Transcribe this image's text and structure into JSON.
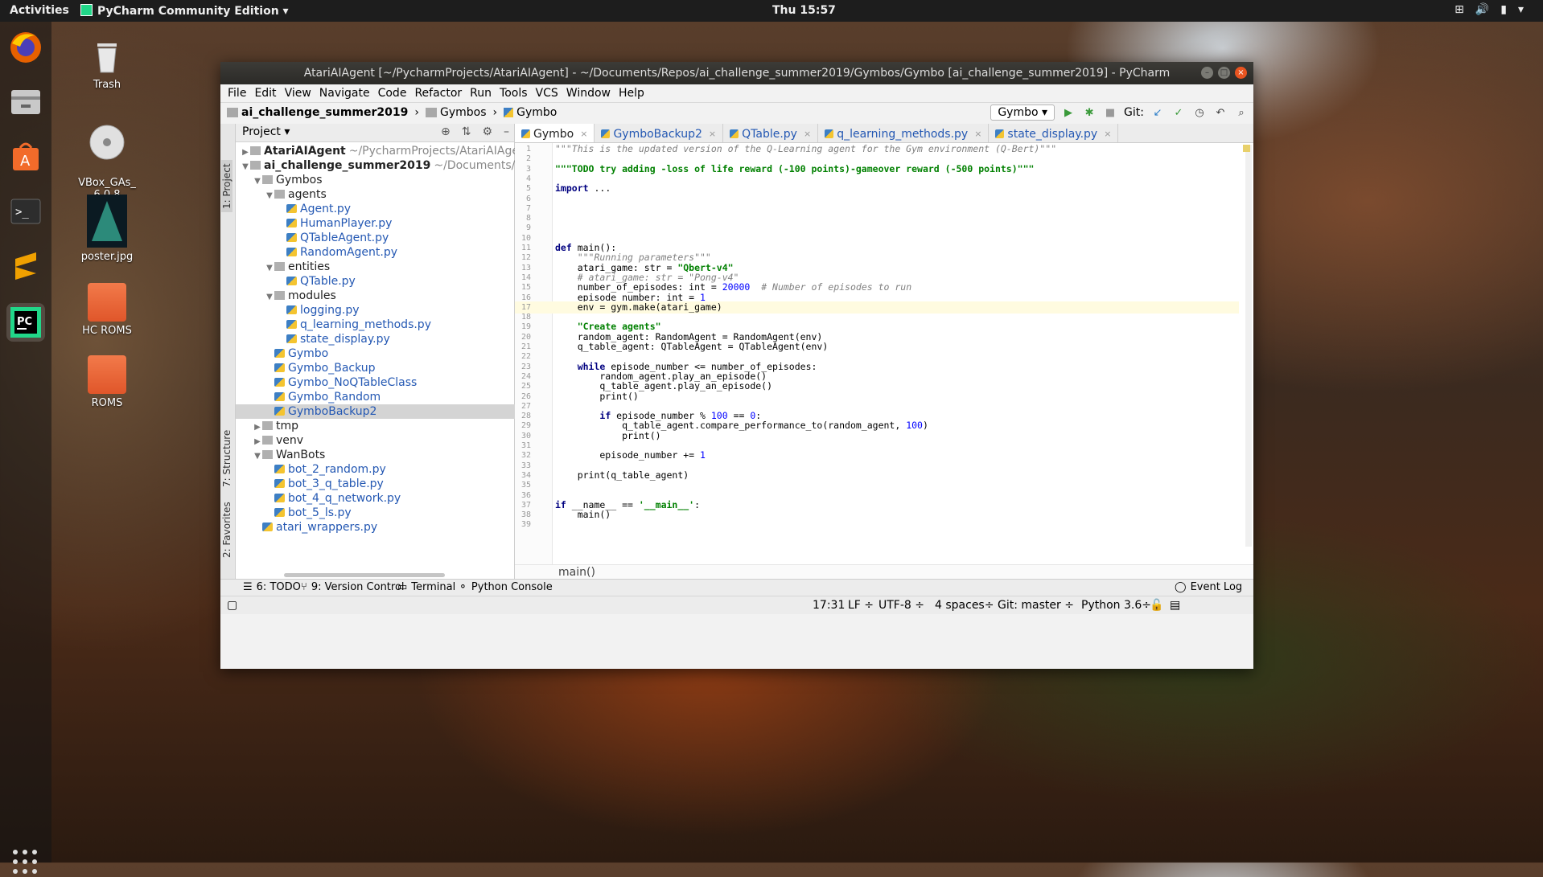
{
  "topbar": {
    "activities": "Activities",
    "app_menu": "PyCharm Community Edition",
    "clock": "Thu 15:57"
  },
  "desktop": {
    "trash": "Trash",
    "vbox": "VBox_GAs_\n6.0.8",
    "poster": "poster.jpg",
    "hc_roms": "HC ROMS",
    "roms": "ROMS"
  },
  "window": {
    "title": "AtariAIAgent [~/PycharmProjects/AtariAIAgent] - ~/Documents/Repos/ai_challenge_summer2019/Gymbos/Gymbo [ai_challenge_summer2019] - PyCharm",
    "menu": [
      "File",
      "Edit",
      "View",
      "Navigate",
      "Code",
      "Refactor",
      "Run",
      "Tools",
      "VCS",
      "Window",
      "Help"
    ],
    "breadcrumbs": [
      "ai_challenge_summer2019",
      "Gymbos",
      "Gymbo"
    ],
    "run_config": "Gymbo",
    "git_label": "Git:",
    "side_tabs": {
      "project": "1: Project",
      "structure": "7: Structure",
      "favorites": "2: Favorites"
    }
  },
  "project_panel": {
    "title": "Project",
    "tree": [
      {
        "name": "AtariAIAgent",
        "path": "~/PycharmProjects/AtariAIAgent",
        "level": 0,
        "type": "root",
        "arrow": "▶"
      },
      {
        "name": "ai_challenge_summer2019",
        "path": "~/Documents/Repos/ai_cha",
        "level": 0,
        "type": "root",
        "arrow": "▼"
      },
      {
        "name": "Gymbos",
        "level": 1,
        "type": "dir",
        "arrow": "▼"
      },
      {
        "name": "agents",
        "level": 2,
        "type": "dir",
        "arrow": "▼"
      },
      {
        "name": "Agent.py",
        "level": 3,
        "type": "file"
      },
      {
        "name": "HumanPlayer.py",
        "level": 3,
        "type": "file"
      },
      {
        "name": "QTableAgent.py",
        "level": 3,
        "type": "file"
      },
      {
        "name": "RandomAgent.py",
        "level": 3,
        "type": "file"
      },
      {
        "name": "entities",
        "level": 2,
        "type": "dir",
        "arrow": "▼"
      },
      {
        "name": "QTable.py",
        "level": 3,
        "type": "file"
      },
      {
        "name": "modules",
        "level": 2,
        "type": "dir",
        "arrow": "▼"
      },
      {
        "name": "logging.py",
        "level": 3,
        "type": "file"
      },
      {
        "name": "q_learning_methods.py",
        "level": 3,
        "type": "file"
      },
      {
        "name": "state_display.py",
        "level": 3,
        "type": "file"
      },
      {
        "name": "Gymbo",
        "level": 2,
        "type": "file"
      },
      {
        "name": "Gymbo_Backup",
        "level": 2,
        "type": "file"
      },
      {
        "name": "Gymbo_NoQTableClass",
        "level": 2,
        "type": "file"
      },
      {
        "name": "Gymbo_Random",
        "level": 2,
        "type": "file"
      },
      {
        "name": "GymboBackup2",
        "level": 2,
        "type": "file",
        "selected": true
      },
      {
        "name": "tmp",
        "level": 1,
        "type": "dir",
        "arrow": "▶"
      },
      {
        "name": "venv",
        "level": 1,
        "type": "dir",
        "arrow": "▶"
      },
      {
        "name": "WanBots",
        "level": 1,
        "type": "dir",
        "arrow": "▼"
      },
      {
        "name": "bot_2_random.py",
        "level": 2,
        "type": "file"
      },
      {
        "name": "bot_3_q_table.py",
        "level": 2,
        "type": "file"
      },
      {
        "name": "bot_4_q_network.py",
        "level": 2,
        "type": "file"
      },
      {
        "name": "bot_5_ls.py",
        "level": 2,
        "type": "file"
      },
      {
        "name": "atari_wrappers.py",
        "level": 1,
        "type": "file"
      }
    ]
  },
  "editor": {
    "tabs": [
      {
        "label": "Gymbo",
        "active": true
      },
      {
        "label": "GymboBackup2",
        "active": false
      },
      {
        "label": "QTable.py",
        "active": false
      },
      {
        "label": "q_learning_methods.py",
        "active": false
      },
      {
        "label": "state_display.py",
        "active": false
      }
    ],
    "lines": [
      "\"\"\"This is the updated version of the Q-Learning agent for the Gym environment (Q-Bert)\"\"\"",
      "",
      "\"\"\"TODO try adding -loss of life reward (-100 points)-gameover reward (-500 points)\"\"\"",
      "",
      "import ...",
      "",
      "",
      "",
      "",
      "",
      "def main():",
      "    \"\"\"Running parameters\"\"\"",
      "    atari_game: str = \"Qbert-v4\"",
      "    # atari_game: str = \"Pong-v4\"",
      "    number_of_episodes: int = 20000  # Number of episodes to run",
      "    episode_number: int = 1",
      "    env = gym.make(atari_game)",
      "",
      "    \"Create agents\"",
      "    random_agent: RandomAgent = RandomAgent(env)",
      "    q_table_agent: QTableAgent = QTableAgent(env)",
      "",
      "    while episode_number <= number_of_episodes:",
      "        random_agent.play_an_episode()",
      "        q_table_agent.play_an_episode()",
      "        print()",
      "",
      "        if episode_number % 100 == 0:",
      "            q_table_agent.compare_performance_to(random_agent, 100)",
      "            print()",
      "",
      "        episode_number += 1",
      "",
      "    print(q_table_agent)",
      "",
      "",
      "if __name__ == '__main__':",
      "    main()",
      ""
    ],
    "current_line": 17,
    "breadcrumb": "main()"
  },
  "bottom_tools": {
    "todo": "6: TODO",
    "vcs": "9: Version Control",
    "terminal": "Terminal",
    "python_console": "Python Console",
    "event_log": "Event Log"
  },
  "status": {
    "position": "17:31",
    "line_sep": "LF ÷",
    "encoding": "UTF-8 ÷",
    "indent": "4 spaces÷",
    "git": "Git: master ÷",
    "python": "Python 3.6÷"
  }
}
